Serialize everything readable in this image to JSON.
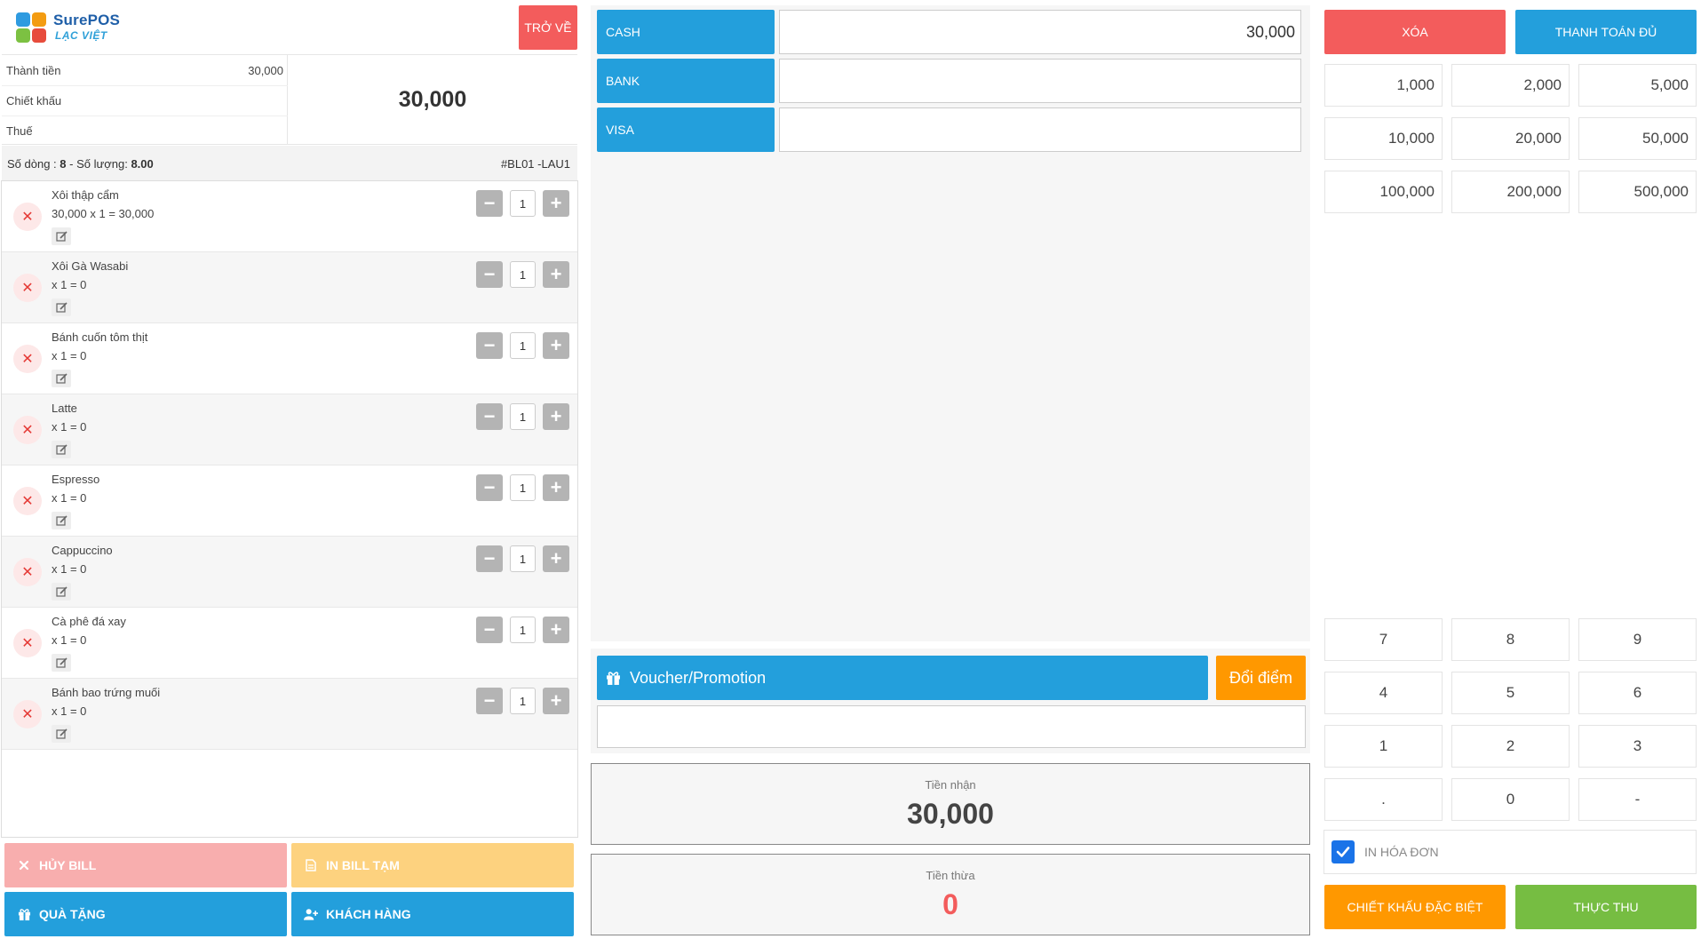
{
  "header": {
    "logo_title": "SurePOS",
    "logo_subtitle": "LẠC VIỆT",
    "back_label": "TRỞ VỀ"
  },
  "summary": {
    "subtotal_label": "Thành tiền",
    "subtotal_value": "30,000",
    "discount_label": "Chiết khấu",
    "discount_value": "",
    "tax_label": "Thuế",
    "tax_value": "",
    "total": "30,000"
  },
  "meta": {
    "lines_label": "Số dòng :",
    "lines_value": "8",
    "separator": "-",
    "qty_label": "Số lượng:",
    "qty_value": "8.00",
    "bill_code": "#BL01 -LAU1"
  },
  "items": [
    {
      "name": "Xôi thập cẩm",
      "line": "30,000 x 1 = 30,000",
      "qty": "1"
    },
    {
      "name": "Xôi Gà Wasabi",
      "line": "x 1 = 0",
      "qty": "1"
    },
    {
      "name": "Bánh cuốn tôm thịt",
      "line": "x 1 = 0",
      "qty": "1"
    },
    {
      "name": "Latte",
      "line": "x 1 = 0",
      "qty": "1"
    },
    {
      "name": "Espresso",
      "line": "x 1 = 0",
      "qty": "1"
    },
    {
      "name": "Cappuccino",
      "line": "x 1 = 0",
      "qty": "1"
    },
    {
      "name": "Cà phê đá xay",
      "line": "x 1 = 0",
      "qty": "1"
    },
    {
      "name": "Bánh bao trứng muối",
      "line": "x 1 = 0",
      "qty": "1"
    }
  ],
  "left_actions": {
    "cancel_bill": "HỦY BILL",
    "print_temp": "IN BILL TẠM",
    "gift": "QUÀ TẶNG",
    "customer": "KHÁCH HÀNG"
  },
  "payments": [
    {
      "label": "CASH",
      "value": "30,000"
    },
    {
      "label": "BANK",
      "value": ""
    },
    {
      "label": "VISA",
      "value": ""
    }
  ],
  "voucher": {
    "label": "Voucher/Promotion",
    "points_label": "Đổi điểm",
    "input_value": ""
  },
  "money": {
    "received_label": "Tiền nhận",
    "received_value": "30,000",
    "change_label": "Tiền thừa",
    "change_value": "0"
  },
  "keypad": {
    "clear_label": "XÓA",
    "pay_full_label": "THANH TOÁN ĐỦ",
    "amounts": [
      "1,000",
      "2,000",
      "5,000",
      "10,000",
      "20,000",
      "50,000",
      "100,000",
      "200,000",
      "500,000"
    ],
    "numbers": [
      "7",
      "8",
      "9",
      "4",
      "5",
      "6",
      "1",
      "2",
      "3",
      ".",
      "0",
      "-"
    ],
    "print_invoice_label": "IN HÓA ĐƠN",
    "print_invoice_checked": true,
    "special_discount_label": "CHIẾT KHẤU ĐẶC BIỆT",
    "collect_label": "THỰC THU"
  },
  "colors": {
    "blue": "#239fdc",
    "red": "#f35c5c",
    "orange": "#ff9800",
    "green": "#76bd42",
    "disabled_red": "#f8aeae",
    "disabled_orange": "#fdd27f",
    "change_red": "#f35c5c"
  }
}
